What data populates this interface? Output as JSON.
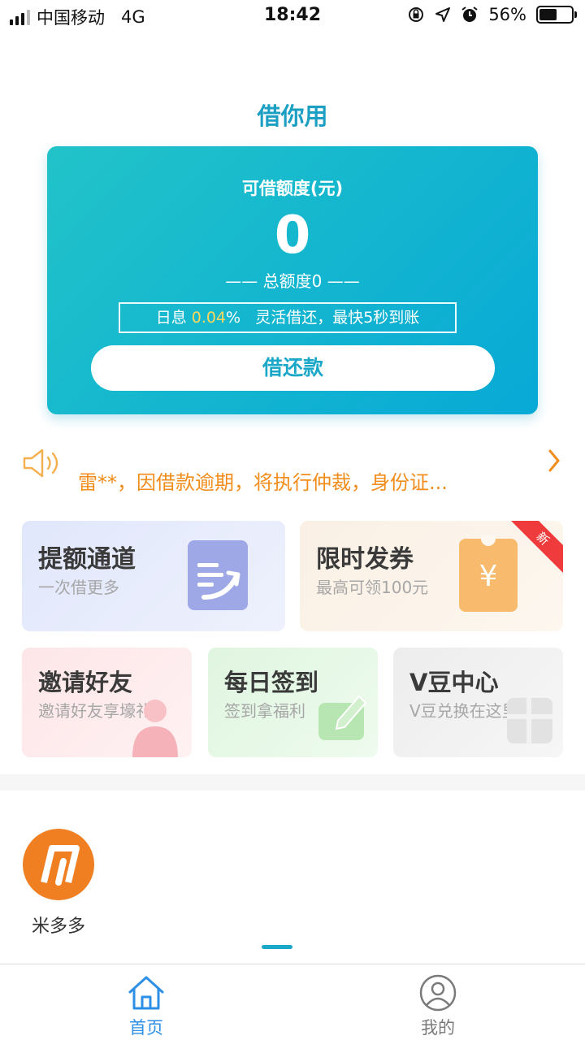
{
  "status_bar": {
    "carrier": "中国移动",
    "network": "4G",
    "time": "18:42",
    "battery_text": "56%",
    "battery_level": 0.56
  },
  "app_title": "借你用",
  "credit_card": {
    "label": "可借额度(元)",
    "amount": "0",
    "total": "—— 总额度0 ——",
    "rate_prefix": "日息 ",
    "rate_value": "0.04",
    "rate_suffix": "%   灵活借还，最快5秒到账",
    "button_label": "借还款"
  },
  "notice": {
    "text": "雷**，因借款逾期，将执行仲裁，身份证...",
    "icon": "speaker-icon"
  },
  "tiles": {
    "raise_limit": {
      "title": "提额通道",
      "subtitle": "一次借更多"
    },
    "coupon": {
      "title": "限时发券",
      "subtitle": "最高可领100元",
      "badge": "新"
    },
    "invite": {
      "title": "邀请好友",
      "subtitle": "邀请好友享壕礼"
    },
    "checkin": {
      "title": "每日签到",
      "subtitle": "签到拿福利"
    },
    "vbean": {
      "title": "V豆中心",
      "subtitle": "V豆兑换在这里"
    }
  },
  "mini_apps": [
    {
      "name": "米多多"
    }
  ],
  "tabbar": {
    "home": "首页",
    "mine": "我的"
  },
  "colors": {
    "accent": "#1aa7c8",
    "notice": "#f28d1c",
    "tab_active": "#2d8fe6"
  }
}
